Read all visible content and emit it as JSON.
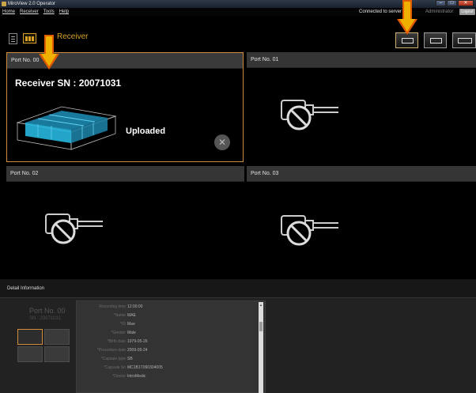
{
  "window": {
    "title": "MiroView 2.0 Operator"
  },
  "menu": [
    "Home",
    "Receiver",
    "Tools",
    "Help"
  ],
  "status": {
    "connection": "Connected to server",
    "user": "Administrator",
    "logout": "Logout"
  },
  "toolbar": {
    "view_label": "Receiver"
  },
  "ports": [
    {
      "label": "Port No. 00",
      "receiver_sn": "Receiver SN : 20071031",
      "status": "Uploaded",
      "active": true
    },
    {
      "label": "Port No. 01",
      "connected": false
    },
    {
      "label": "Port No. 02",
      "connected": false
    },
    {
      "label": "Port No. 03",
      "connected": false
    }
  ],
  "detail": {
    "header": "Detail Information",
    "port_label": "Port No. 00",
    "sn_label": "SN : 20071031",
    "fields": [
      {
        "key": "Recording time",
        "value": "12:00:00"
      },
      {
        "key": "*Name",
        "value": "MAE"
      },
      {
        "key": "*ID",
        "value": "Mae"
      },
      {
        "key": "*Gender",
        "value": "Male"
      },
      {
        "key": "*Birth date",
        "value": "1979-05-26"
      },
      {
        "key": "*Procedure date",
        "value": "2009-05-24"
      },
      {
        "key": "*Capsule type",
        "value": "SB"
      },
      {
        "key": "*Capsule Sn",
        "value": "MC1B1T090304005"
      },
      {
        "key": "*Doctor",
        "value": "IntroMedic"
      }
    ]
  },
  "colors": {
    "accent": "#d7a125",
    "active_border": "#d08d3a",
    "arrow": "#f0b000"
  },
  "icons": {
    "list": "list-icon",
    "receiver": "receiver-icon",
    "no_connection": "no-connection-icon",
    "close": "close-icon"
  }
}
